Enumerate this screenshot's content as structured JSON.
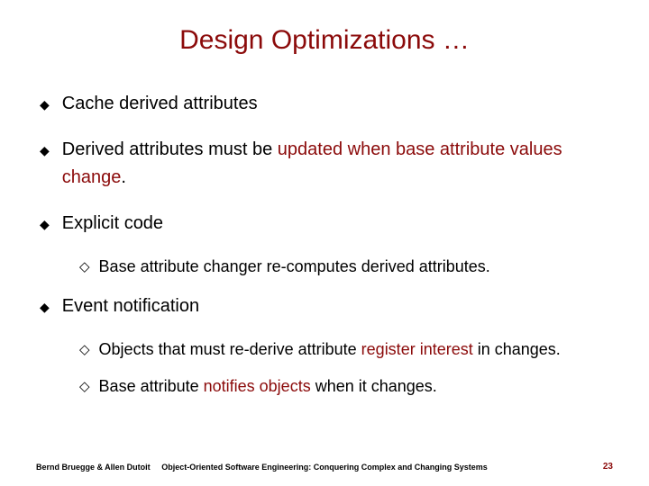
{
  "title": "Design Optimizations …",
  "bullets": {
    "b1": "Cache derived attributes",
    "b2_pre": "Derived attributes must be ",
    "b2_accent": "updated when base attribute values change",
    "b2_post": ".",
    "b3": "Explicit code",
    "b3_1": "Base attribute changer re-computes derived attributes.",
    "b4": "Event notification",
    "b4_1_pre": "Objects that must re-derive attribute ",
    "b4_1_accent": "register interest",
    "b4_1_post": " in changes.",
    "b4_2_pre": "Base attribute ",
    "b4_2_accent": "notifies objects",
    "b4_2_post": " when it changes."
  },
  "footer": {
    "left": "Bernd Bruegge & Allen Dutoit",
    "center": "Object-Oriented Software Engineering: Conquering Complex and Changing Systems",
    "right": "23"
  },
  "colors": {
    "accent": "#8b0a0a"
  }
}
